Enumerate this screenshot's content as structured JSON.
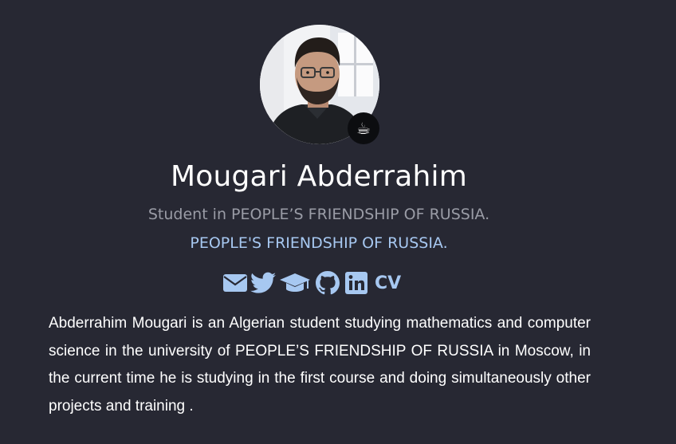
{
  "profile": {
    "name": "Mougari Abderrahim",
    "subtitle": "Student in PEOPLE’S FRIENDSHIP OF RUSSIA.",
    "affiliation": "PEOPLE'S FRIENDSHIP OF RUSSIA.",
    "status_emoji": "☕",
    "avatar_icon": "profile-photo"
  },
  "social": {
    "links": [
      {
        "name": "email",
        "icon": "envelope-icon"
      },
      {
        "name": "twitter",
        "icon": "twitter-icon"
      },
      {
        "name": "scholar",
        "icon": "graduation-cap-icon"
      },
      {
        "name": "github",
        "icon": "github-icon"
      },
      {
        "name": "linkedin",
        "icon": "linkedin-icon"
      }
    ],
    "cv_label": "CV"
  },
  "bio": {
    "text": "Abderrahim Mougari is an Algerian student studying mathematics and computer science in the university of PEOPLE’S FRIENDSHIP OF RUSSIA in Moscow, in the current time he is studying in the first course and doing simultaneously other projects and training ."
  },
  "colors": {
    "background": "#272833",
    "accent": "#a7c8f1",
    "muted": "#9a9ca6",
    "text": "#ffffff"
  }
}
